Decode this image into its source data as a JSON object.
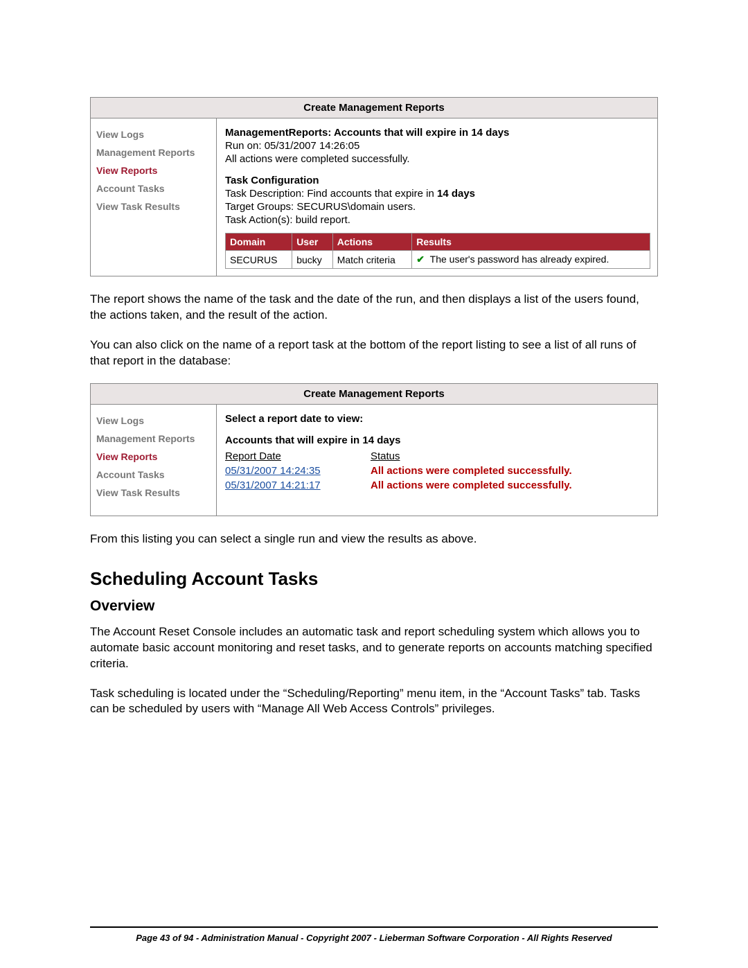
{
  "panel1": {
    "title": "Create Management Reports",
    "sidebar": [
      {
        "label": "View Logs",
        "active": false
      },
      {
        "label": "Management Reports",
        "active": false
      },
      {
        "label": "View Reports",
        "active": true
      },
      {
        "label": "Account Tasks",
        "active": false
      },
      {
        "label": "View Task Results",
        "active": false
      }
    ],
    "report_prefix": "ManagementReports: ",
    "report_name": "Accounts that will expire in 14 days",
    "run_on": "Run on: 05/31/2007 14:26:05",
    "actions_complete": "All actions were completed successfully.",
    "task_config_header": "Task Configuration",
    "task_desc_prefix": "Task Description: Find accounts that expire in ",
    "task_desc_days": "14 days",
    "target_groups": "Target Groups: SECURUS\\domain users.",
    "task_actions": "Task Action(s): build report.",
    "table_headers": {
      "domain": "Domain",
      "user": "User",
      "actions": "Actions",
      "results": "Results"
    },
    "rows": [
      {
        "domain": "SECURUS",
        "user": "bucky",
        "actions": "Match criteria",
        "result": "The user's password has already expired."
      }
    ]
  },
  "para1": "The report shows the name of the task and the date of the run, and then displays a list of the users found, the actions taken, and the result of the action.",
  "para2": "You can also click on the name of a report task at the bottom of the report listing to see a list of all runs of that report in the database:",
  "panel2": {
    "title": "Create Management Reports",
    "sidebar": [
      {
        "label": "View Logs",
        "active": false
      },
      {
        "label": "Management Reports",
        "active": false
      },
      {
        "label": "View Reports",
        "active": true
      },
      {
        "label": "Account Tasks",
        "active": false
      },
      {
        "label": "View Task Results",
        "active": false
      }
    ],
    "select_label": "Select a report date to view:",
    "report_name": "Accounts that will expire in 14 days",
    "col_date": "Report Date",
    "col_status": "Status",
    "rows": [
      {
        "date": "05/31/2007 14:24:35",
        "status": "All actions were completed successfully."
      },
      {
        "date": "05/31/2007 14:21:17",
        "status": "All actions were completed successfully."
      }
    ]
  },
  "para3": "From this listing you can select a single run and view the results as above.",
  "heading_sched": "Scheduling Account Tasks",
  "heading_overview": "Overview",
  "para4": "The Account Reset Console includes an automatic task and report scheduling system which allows you to automate basic account monitoring and reset tasks, and to generate reports on accounts matching specified criteria.",
  "para5": "Task scheduling is located under the “Scheduling/Reporting” menu item, in the “Account Tasks” tab.  Tasks can be scheduled by users with “Manage All Web Access Controls” privileges.",
  "footer": "Page 43 of 94 - Administration Manual - Copyright 2007 - Lieberman Software Corporation - All Rights Reserved"
}
